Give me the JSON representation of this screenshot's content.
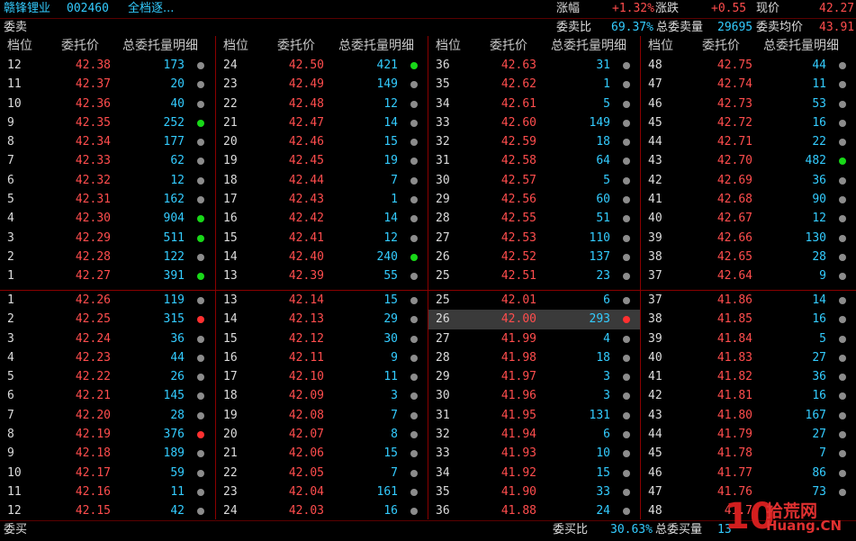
{
  "title": {
    "stock_name": "赣锋锂业",
    "stock_code": "002460",
    "mode": "全档逐...",
    "change_pct_label": "涨幅",
    "change_pct": "+1.32%",
    "change_label": "涨跌",
    "change": "+0.55",
    "price_label": "现价",
    "price": "42.27"
  },
  "sell_bar": {
    "label": "委卖",
    "ratio_label": "委卖比",
    "ratio": "69.37%",
    "total_label": "总委卖量",
    "total": "29695",
    "avg_label": "委卖均价",
    "avg": "43.91"
  },
  "buy_bar": {
    "label": "委买",
    "ratio_label": "委买比",
    "ratio": "30.63%",
    "total_label": "总委买量",
    "total": "13"
  },
  "headers": {
    "level": "档位",
    "price": "委托价",
    "detail": "总委托量明细"
  },
  "sell_columns": [
    [
      {
        "l": "12",
        "p": "42.38",
        "v": "173",
        "d": "gray"
      },
      {
        "l": "11",
        "p": "42.37",
        "v": "20",
        "d": "gray"
      },
      {
        "l": "10",
        "p": "42.36",
        "v": "40",
        "d": "gray"
      },
      {
        "l": "9",
        "p": "42.35",
        "v": "252",
        "d": "green"
      },
      {
        "l": "8",
        "p": "42.34",
        "v": "177",
        "d": "gray"
      },
      {
        "l": "7",
        "p": "42.33",
        "v": "62",
        "d": "gray"
      },
      {
        "l": "6",
        "p": "42.32",
        "v": "12",
        "d": "gray"
      },
      {
        "l": "5",
        "p": "42.31",
        "v": "162",
        "d": "gray"
      },
      {
        "l": "4",
        "p": "42.30",
        "v": "904",
        "d": "green"
      },
      {
        "l": "3",
        "p": "42.29",
        "v": "511",
        "d": "green"
      },
      {
        "l": "2",
        "p": "42.28",
        "v": "122",
        "d": "gray"
      },
      {
        "l": "1",
        "p": "42.27",
        "v": "391",
        "d": "green"
      }
    ],
    [
      {
        "l": "24",
        "p": "42.50",
        "v": "421",
        "d": "green"
      },
      {
        "l": "23",
        "p": "42.49",
        "v": "149",
        "d": "gray"
      },
      {
        "l": "22",
        "p": "42.48",
        "v": "12",
        "d": "gray"
      },
      {
        "l": "21",
        "p": "42.47",
        "v": "14",
        "d": "gray"
      },
      {
        "l": "20",
        "p": "42.46",
        "v": "15",
        "d": "gray"
      },
      {
        "l": "19",
        "p": "42.45",
        "v": "19",
        "d": "gray"
      },
      {
        "l": "18",
        "p": "42.44",
        "v": "7",
        "d": "gray"
      },
      {
        "l": "17",
        "p": "42.43",
        "v": "1",
        "d": "gray"
      },
      {
        "l": "16",
        "p": "42.42",
        "v": "14",
        "d": "gray"
      },
      {
        "l": "15",
        "p": "42.41",
        "v": "12",
        "d": "gray"
      },
      {
        "l": "14",
        "p": "42.40",
        "v": "240",
        "d": "green"
      },
      {
        "l": "13",
        "p": "42.39",
        "v": "55",
        "d": "gray"
      }
    ],
    [
      {
        "l": "36",
        "p": "42.63",
        "v": "31",
        "d": "gray"
      },
      {
        "l": "35",
        "p": "42.62",
        "v": "1",
        "d": "gray"
      },
      {
        "l": "34",
        "p": "42.61",
        "v": "5",
        "d": "gray"
      },
      {
        "l": "33",
        "p": "42.60",
        "v": "149",
        "d": "gray"
      },
      {
        "l": "32",
        "p": "42.59",
        "v": "18",
        "d": "gray"
      },
      {
        "l": "31",
        "p": "42.58",
        "v": "64",
        "d": "gray"
      },
      {
        "l": "30",
        "p": "42.57",
        "v": "5",
        "d": "gray"
      },
      {
        "l": "29",
        "p": "42.56",
        "v": "60",
        "d": "gray"
      },
      {
        "l": "28",
        "p": "42.55",
        "v": "51",
        "d": "gray"
      },
      {
        "l": "27",
        "p": "42.53",
        "v": "110",
        "d": "gray"
      },
      {
        "l": "26",
        "p": "42.52",
        "v": "137",
        "d": "gray"
      },
      {
        "l": "25",
        "p": "42.51",
        "v": "23",
        "d": "gray"
      }
    ],
    [
      {
        "l": "48",
        "p": "42.75",
        "v": "44",
        "d": "gray"
      },
      {
        "l": "47",
        "p": "42.74",
        "v": "11",
        "d": "gray"
      },
      {
        "l": "46",
        "p": "42.73",
        "v": "53",
        "d": "gray"
      },
      {
        "l": "45",
        "p": "42.72",
        "v": "16",
        "d": "gray"
      },
      {
        "l": "44",
        "p": "42.71",
        "v": "22",
        "d": "gray"
      },
      {
        "l": "43",
        "p": "42.70",
        "v": "482",
        "d": "green"
      },
      {
        "l": "42",
        "p": "42.69",
        "v": "36",
        "d": "gray"
      },
      {
        "l": "41",
        "p": "42.68",
        "v": "90",
        "d": "gray"
      },
      {
        "l": "40",
        "p": "42.67",
        "v": "12",
        "d": "gray"
      },
      {
        "l": "39",
        "p": "42.66",
        "v": "130",
        "d": "gray"
      },
      {
        "l": "38",
        "p": "42.65",
        "v": "28",
        "d": "gray"
      },
      {
        "l": "37",
        "p": "42.64",
        "v": "9",
        "d": "gray"
      }
    ]
  ],
  "buy_columns": [
    [
      {
        "l": "1",
        "p": "42.26",
        "v": "119",
        "d": "gray"
      },
      {
        "l": "2",
        "p": "42.25",
        "v": "315",
        "d": "red"
      },
      {
        "l": "3",
        "p": "42.24",
        "v": "36",
        "d": "gray"
      },
      {
        "l": "4",
        "p": "42.23",
        "v": "44",
        "d": "gray"
      },
      {
        "l": "5",
        "p": "42.22",
        "v": "26",
        "d": "gray"
      },
      {
        "l": "6",
        "p": "42.21",
        "v": "145",
        "d": "gray"
      },
      {
        "l": "7",
        "p": "42.20",
        "v": "28",
        "d": "gray"
      },
      {
        "l": "8",
        "p": "42.19",
        "v": "376",
        "d": "red"
      },
      {
        "l": "9",
        "p": "42.18",
        "v": "189",
        "d": "gray"
      },
      {
        "l": "10",
        "p": "42.17",
        "v": "59",
        "d": "gray"
      },
      {
        "l": "11",
        "p": "42.16",
        "v": "11",
        "d": "gray"
      },
      {
        "l": "12",
        "p": "42.15",
        "v": "42",
        "d": "gray"
      }
    ],
    [
      {
        "l": "13",
        "p": "42.14",
        "v": "15",
        "d": "gray"
      },
      {
        "l": "14",
        "p": "42.13",
        "v": "29",
        "d": "gray"
      },
      {
        "l": "15",
        "p": "42.12",
        "v": "30",
        "d": "gray"
      },
      {
        "l": "16",
        "p": "42.11",
        "v": "9",
        "d": "gray"
      },
      {
        "l": "17",
        "p": "42.10",
        "v": "11",
        "d": "gray"
      },
      {
        "l": "18",
        "p": "42.09",
        "v": "3",
        "d": "gray"
      },
      {
        "l": "19",
        "p": "42.08",
        "v": "7",
        "d": "gray"
      },
      {
        "l": "20",
        "p": "42.07",
        "v": "8",
        "d": "gray"
      },
      {
        "l": "21",
        "p": "42.06",
        "v": "15",
        "d": "gray"
      },
      {
        "l": "22",
        "p": "42.05",
        "v": "7",
        "d": "gray"
      },
      {
        "l": "23",
        "p": "42.04",
        "v": "161",
        "d": "gray"
      },
      {
        "l": "24",
        "p": "42.03",
        "v": "16",
        "d": "gray"
      }
    ],
    [
      {
        "l": "25",
        "p": "42.01",
        "v": "6",
        "d": "gray"
      },
      {
        "l": "26",
        "p": "42.00",
        "v": "293",
        "d": "red",
        "sel": true
      },
      {
        "l": "27",
        "p": "41.99",
        "v": "4",
        "d": "gray"
      },
      {
        "l": "28",
        "p": "41.98",
        "v": "18",
        "d": "gray"
      },
      {
        "l": "29",
        "p": "41.97",
        "v": "3",
        "d": "gray"
      },
      {
        "l": "30",
        "p": "41.96",
        "v": "3",
        "d": "gray"
      },
      {
        "l": "31",
        "p": "41.95",
        "v": "131",
        "d": "gray"
      },
      {
        "l": "32",
        "p": "41.94",
        "v": "6",
        "d": "gray"
      },
      {
        "l": "33",
        "p": "41.93",
        "v": "10",
        "d": "gray"
      },
      {
        "l": "34",
        "p": "41.92",
        "v": "15",
        "d": "gray"
      },
      {
        "l": "35",
        "p": "41.90",
        "v": "33",
        "d": "gray"
      },
      {
        "l": "36",
        "p": "41.88",
        "v": "24",
        "d": "gray"
      }
    ],
    [
      {
        "l": "37",
        "p": "41.86",
        "v": "14",
        "d": "gray"
      },
      {
        "l": "38",
        "p": "41.85",
        "v": "16",
        "d": "gray"
      },
      {
        "l": "39",
        "p": "41.84",
        "v": "5",
        "d": "gray"
      },
      {
        "l": "40",
        "p": "41.83",
        "v": "27",
        "d": "gray"
      },
      {
        "l": "41",
        "p": "41.82",
        "v": "36",
        "d": "gray"
      },
      {
        "l": "42",
        "p": "41.81",
        "v": "16",
        "d": "gray"
      },
      {
        "l": "43",
        "p": "41.80",
        "v": "167",
        "d": "gray"
      },
      {
        "l": "44",
        "p": "41.79",
        "v": "27",
        "d": "gray"
      },
      {
        "l": "45",
        "p": "41.78",
        "v": "7",
        "d": "gray"
      },
      {
        "l": "46",
        "p": "41.77",
        "v": "86",
        "d": "gray"
      },
      {
        "l": "47",
        "p": "41.76",
        "v": "73",
        "d": "gray"
      },
      {
        "l": "48",
        "p": "41.7",
        "v": "",
        "d": "none"
      }
    ]
  ],
  "watermark": {
    "num": "10",
    "cn": "拾荒网",
    "en": "Huang.CN"
  }
}
